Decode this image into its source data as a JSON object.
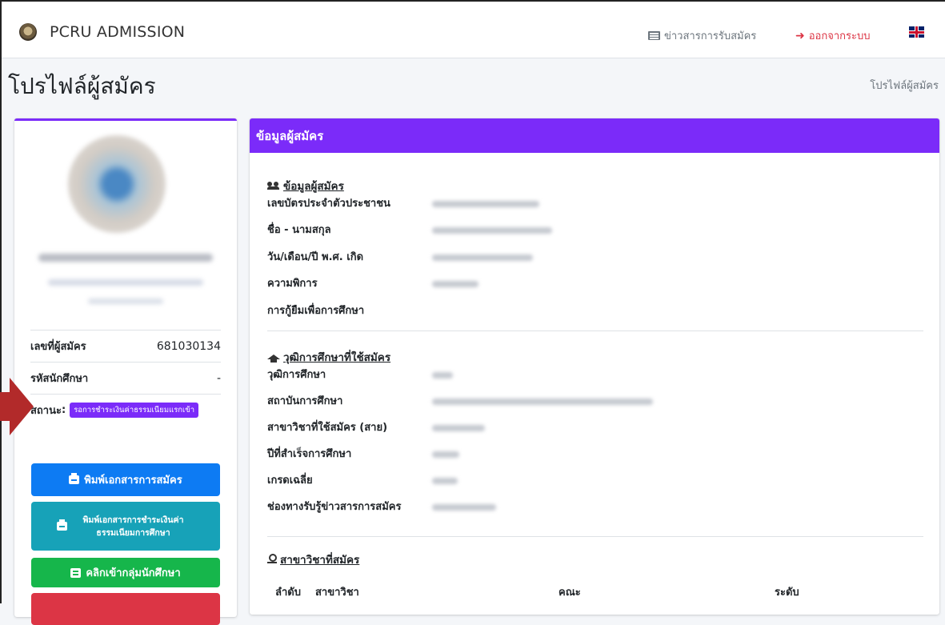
{
  "navbar": {
    "brand": "PCRU ADMISSION",
    "news_label": "ข่าวสารการรับสมัคร",
    "logout_label": "ออกจากระบบ"
  },
  "page": {
    "title": "โปรไฟล์ผู้สมัคร",
    "breadcrumb": "โปรไฟล์ผู้สมัคร"
  },
  "profile": {
    "rows": [
      {
        "label": "เลขที่ผู้สมัคร",
        "value": "681030134"
      },
      {
        "label": "รหัสนักศึกษา",
        "value": "-"
      },
      {
        "label": "สถานะ",
        "value": "รอการชำระเงินค่าธรรมเนียมแรกเข้า"
      }
    ],
    "buttons": {
      "print_application": "พิมพ์เอกสารการสมัคร",
      "print_payment": "พิมพ์เอกสารการชำระเงินค่าธรรมเนียมการศึกษา",
      "join_group": "คลิกเข้ากลุ่มนักศึกษา"
    }
  },
  "main": {
    "header": "ข้อมูลผู้สมัคร",
    "applicant_section": {
      "title": "ข้อมูลผู้สมัคร",
      "fields": [
        "เลขบัตรประจำตัวประชาชน",
        "ชื่อ - นามสกุล",
        "วัน/เดือน/ปี พ.ศ. เกิด",
        "ความพิการ",
        "การกู้ยืมเพื่อการศึกษา"
      ]
    },
    "education_section": {
      "title": "วุฒิการศึกษาที่ใช้สมัคร",
      "fields": [
        "วุฒิการศึกษา",
        "สถาบันการศึกษา",
        "สาขาวิชาที่ใช้สมัคร (สาย)",
        "ปีที่สำเร็จการศึกษา",
        "เกรดเฉลี่ย",
        "ช่องทางรับรู้ข่าวสารการสมัคร"
      ]
    },
    "major_section": {
      "title": "สาขาวิชาที่สมัคร",
      "columns": [
        "ลำดับ",
        "สาขาวิชา",
        "คณะ",
        "ระดับ"
      ]
    }
  },
  "colors": {
    "accent": "#7b2bf9",
    "primary_button": "#0d7bf3",
    "info_button": "#17a2b8",
    "success_button": "#16b64b",
    "danger": "#dc3545"
  },
  "icons": [
    "newspaper-icon",
    "sign-out-icon",
    "uk-flag-icon",
    "users-icon",
    "graduation-cap-icon",
    "person-icon",
    "printer-icon",
    "chat-icon"
  ]
}
